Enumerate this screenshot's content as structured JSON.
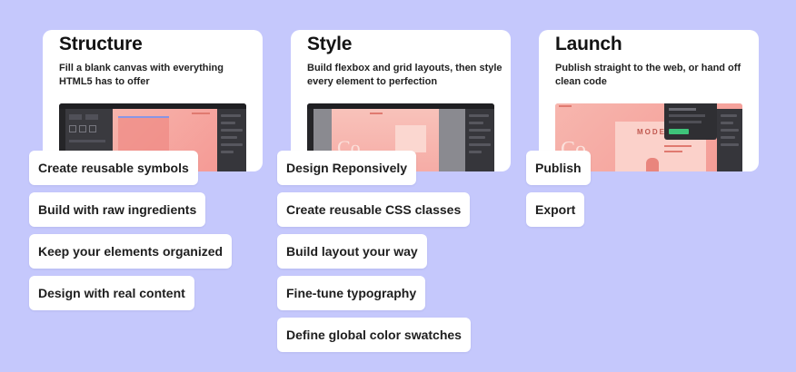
{
  "columns": [
    {
      "title": "Structure",
      "description": "Fill a blank canvas with everything HTML5 has to offer",
      "features": [
        "Create reusable symbols",
        "Build with raw ingredients",
        "Keep your elements organized",
        "Design with real content"
      ]
    },
    {
      "title": "Style",
      "description": "Build flexbox and grid layouts, then style every element to perfection",
      "features": [
        "Design Reponsively",
        "Create reusable CSS classes",
        "Build layout your way",
        "Fine-tune typography",
        "Define global color swatches"
      ]
    },
    {
      "title": "Launch",
      "description": "Publish straight to the web, or hand off clean code",
      "features": [
        "Publish",
        "Export"
      ],
      "screenshot_heading": "MODERN"
    }
  ],
  "colors": {
    "background": "#c5c8fc",
    "card": "#ffffff",
    "editor_dark": "#2f2f33",
    "canvas_pink": "#f4a3a0",
    "canvas_accent": "#f08a84"
  }
}
